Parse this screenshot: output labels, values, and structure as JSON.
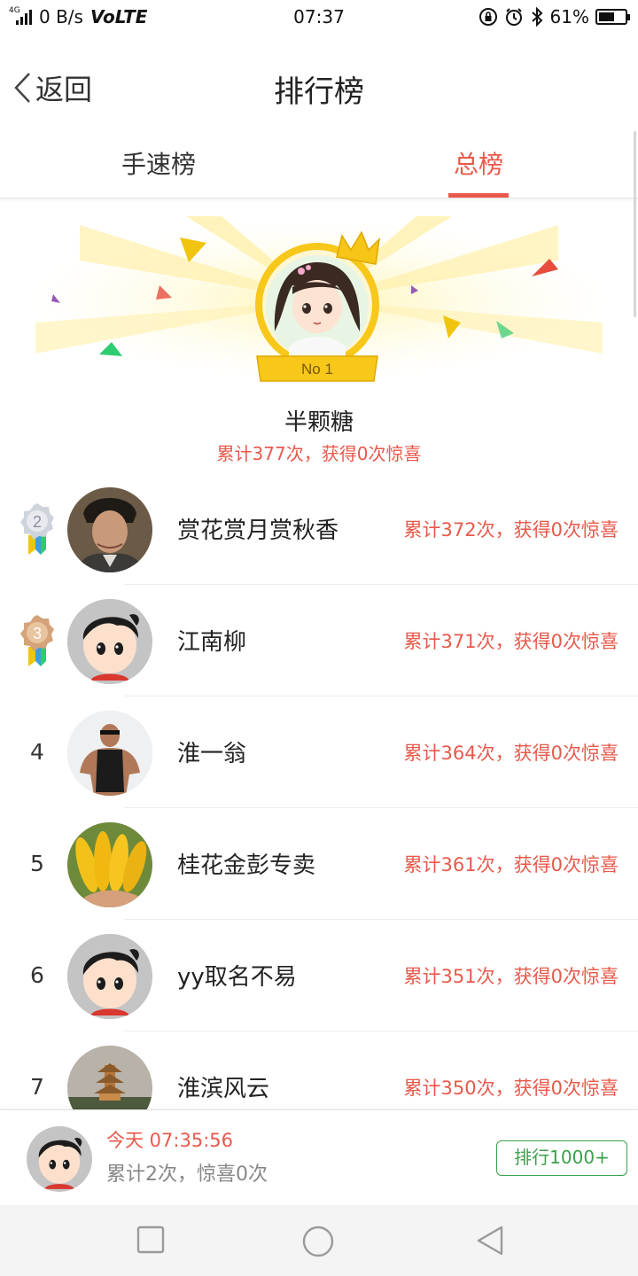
{
  "status_bar": {
    "net_type": "4G",
    "speed": "0 B/s",
    "volte": "VoLTE",
    "time": "07:37",
    "battery": "61%",
    "battery_level": 0.61
  },
  "nav": {
    "back_label": "返回",
    "title": "排行榜"
  },
  "tabs": [
    {
      "label": "手速榜",
      "active": false
    },
    {
      "label": "总榜",
      "active": true
    }
  ],
  "champion": {
    "badge": "No 1",
    "name": "半颗糖",
    "stats": "累计377次，获得0次惊喜"
  },
  "rankings": [
    {
      "rank": "2",
      "name": "赏花赏月赏秋香",
      "stats": "累计372次，获得0次惊喜",
      "avatar": "photo-man"
    },
    {
      "rank": "3",
      "name": "江南柳",
      "stats": "累计371次，获得0次惊喜",
      "avatar": "default-cartoon"
    },
    {
      "rank": "4",
      "name": "淮一翁",
      "stats": "累计364次，获得0次惊喜",
      "avatar": "photo-gym"
    },
    {
      "rank": "5",
      "name": "桂花金彭专卖",
      "stats": "累计361次，获得0次惊喜",
      "avatar": "photo-flowers"
    },
    {
      "rank": "6",
      "name": "yy取名不易",
      "stats": "累计351次，获得0次惊喜",
      "avatar": "default-cartoon"
    },
    {
      "rank": "7",
      "name": "淮滨风云",
      "stats": "累计350次，获得0次惊喜",
      "avatar": "photo-pagoda"
    }
  ],
  "my_record": {
    "time": "今天 07:35:56",
    "stats": "累计2次，惊喜0次",
    "rank_button": "排行1000+"
  },
  "colors": {
    "accent": "#e8594b",
    "green": "#3aa04a",
    "gold": "#f5c518"
  }
}
